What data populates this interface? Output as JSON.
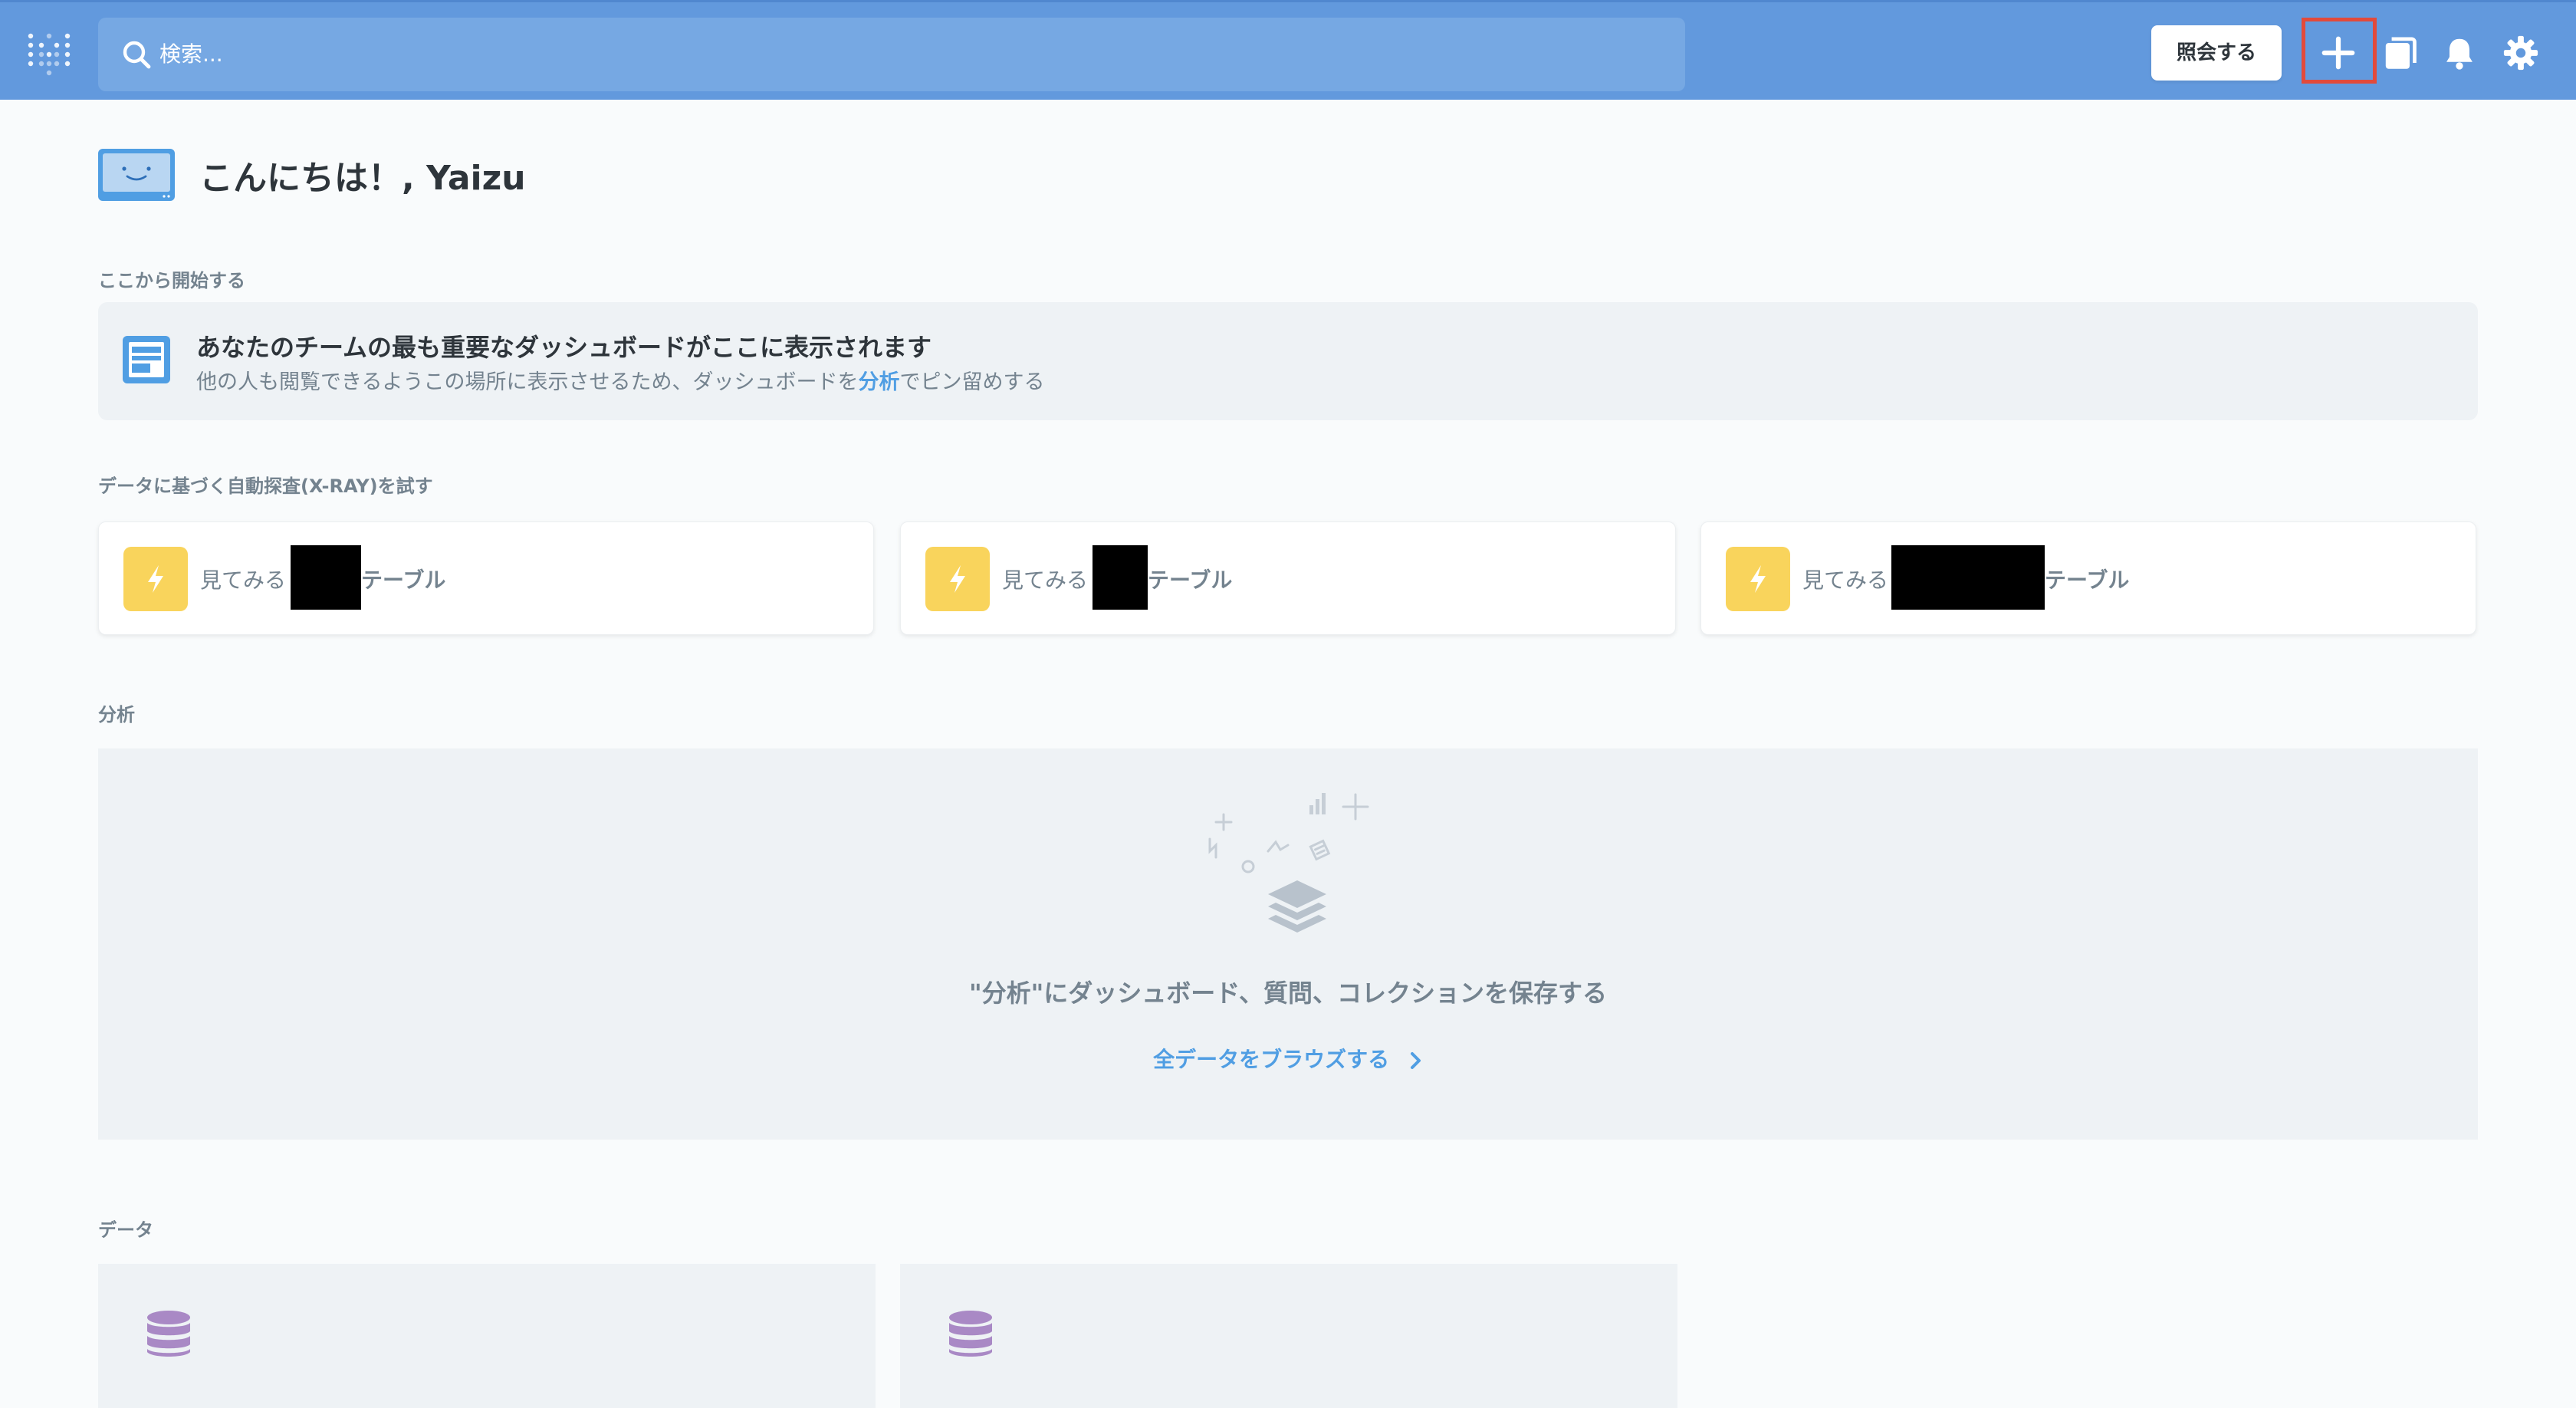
{
  "header": {
    "search_placeholder": "検索...",
    "query_button": "照会する"
  },
  "greeting": "こんにちは！, Yaizu",
  "sections": {
    "start_here": "ここから開始する",
    "xray": "データに基づく自動探査(X-RAY)を試す",
    "analytics": "分析",
    "data": "データ"
  },
  "pinned": {
    "title": "あなたのチームの最も重要なダッシュボードがここに表示されます",
    "subtitle_before": "他の人も閲覧できるようこの場所に表示させるため、ダッシュボードを",
    "subtitle_link": "分析",
    "subtitle_after": "でピン留めする"
  },
  "xray_cards": [
    {
      "prefix": "見てみる",
      "suffix": "テーブル"
    },
    {
      "prefix": "見てみる",
      "suffix": "テーブル"
    },
    {
      "prefix": "見てみる",
      "suffix": "テーブル"
    }
  ],
  "analytics_empty": {
    "message": "\"分析\"にダッシュボード、質問、コレクションを保存する",
    "browse_link": "全データをブラウズする"
  },
  "colors": {
    "navbar": "#6299dd",
    "brand": "#509ee3",
    "bolt": "#f9d45c",
    "database": "#a989c5",
    "highlight": "#e24a3b"
  },
  "icons": [
    "logo-icon",
    "search-icon",
    "plus-icon",
    "collection-icon",
    "bell-icon",
    "gear-icon",
    "database-icon"
  ]
}
